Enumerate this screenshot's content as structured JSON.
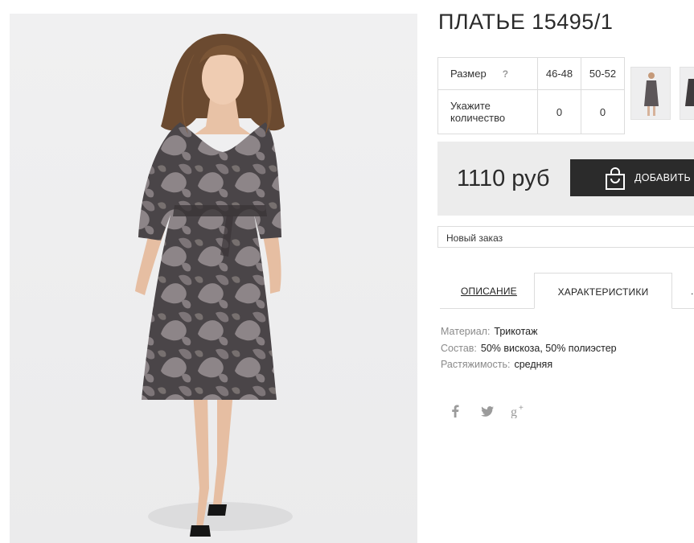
{
  "product": {
    "title": "ПЛАТЬЕ 15495/1",
    "image_alt": "dress-photo"
  },
  "size_table": {
    "size_label": "Размер",
    "help_label": "?",
    "sizes": [
      "46-48",
      "50-52"
    ],
    "qty_label_line1": "Укажите",
    "qty_label_line2": "количество",
    "quantities": [
      "0",
      "0"
    ]
  },
  "price": {
    "amount": "1110 руб",
    "cart_label": "ДОБАВИТЬ В"
  },
  "order": {
    "selected": "Новый заказ"
  },
  "tabs": {
    "description": "ОПИСАНИЕ",
    "characteristics": "ХАРАКТЕРИСТИКИ",
    "more": "..."
  },
  "specs": [
    {
      "key": "Материал:",
      "value": "Трикотаж"
    },
    {
      "key": "Состав:",
      "value": "50% вискоза, 50% полиэстер"
    },
    {
      "key": "Растяжимость:",
      "value": "средняя"
    }
  ],
  "social": {
    "facebook": "f",
    "twitter": "twitter",
    "googleplus": "g+"
  },
  "colors": {
    "dark": "#2b2b2b",
    "panel": "#ececec",
    "border": "#dcdcdc",
    "muted": "#8a8a8a"
  }
}
